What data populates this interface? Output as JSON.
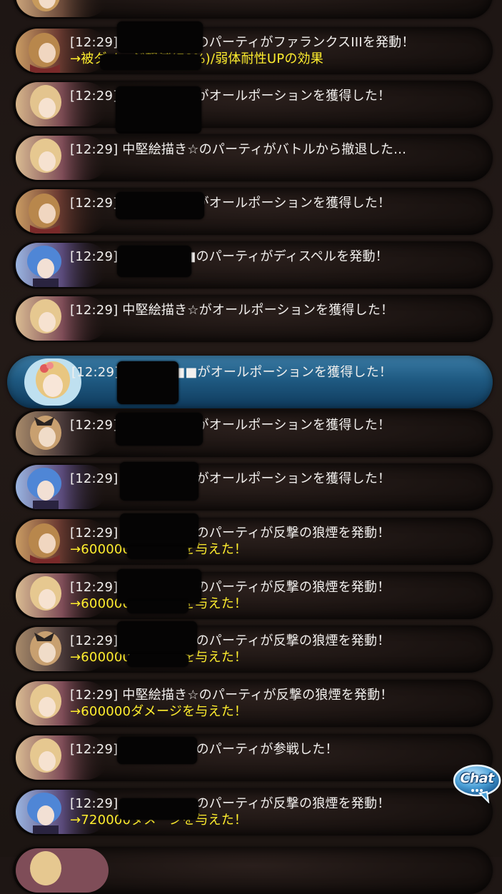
{
  "log": [
    {
      "avatar": "blonde-braid-icon",
      "line1": "[12:29]",
      "line2": ""
    },
    {
      "avatar": "blonde-braid-icon",
      "line1": "[12:29] ■■■■■■のパーティがファランクスIIIを発動！",
      "line2": "→被ダメージ軽減(70%)/弱体耐性UPの効果"
    },
    {
      "avatar": "blonde-girl-icon",
      "line1": "[12:29] ■■■■■■がオールポーションを獲得した！",
      "line2": ""
    },
    {
      "avatar": "blonde-girl-icon",
      "line1": "[12:29] 中堅絵描き☆のパーティがバトルから撤退した…",
      "line2": ""
    },
    {
      "avatar": "blonde-braid-icon",
      "line1": "[12:29] ■■■■■■がオールポーションを獲得した！",
      "line2": ""
    },
    {
      "avatar": "blue-hair-icon",
      "line1": "[12:29] ■■■■■■のパーティがディスペルを発動！",
      "line2": ""
    },
    {
      "avatar": "blonde-girl-icon",
      "line1": "[12:29] 中堅絵描き☆がオールポーションを獲得した！",
      "line2": ""
    },
    {
      "avatar": "blonde-flower-icon",
      "line1": "[12:29] ■■■■■■がオールポーションを獲得した！",
      "line2": ""
    },
    {
      "avatar": "dark-bow-icon",
      "line1": "[12:29] ■■■■■■がオールポーションを獲得した！",
      "line2": ""
    },
    {
      "avatar": "blue-hair-icon",
      "line1": "[12:29] ■■■■■■がオールポーションを獲得した！",
      "line2": ""
    },
    {
      "avatar": "blonde-braid-icon",
      "line1": "[12:29] ■■■■■■のパーティが反撃の狼煙を発動！",
      "line2": "→600000ダメージを与えた！"
    },
    {
      "avatar": "blonde-girl-icon",
      "line1": "[12:29] ■■■■■■のパーティが反撃の狼煙を発動！",
      "line2": "→600000ダメージを与えた！"
    },
    {
      "avatar": "dark-bow-icon",
      "line1": "[12:29] ■■■■■■のパーティが反撃の狼煙を発動！",
      "line2": "→600000ダメージを与えた！"
    },
    {
      "avatar": "blonde-girl-icon",
      "line1": "[12:29] 中堅絵描き☆のパーティが反撃の狼煙を発動！",
      "line2": "→600000ダメージを与えた！"
    },
    {
      "avatar": "blonde-girl-icon",
      "line1": "[12:29] ■■■■■■のパーティが参戦した！",
      "line2": ""
    },
    {
      "avatar": "blue-hair-icon",
      "line1": "[12:29] ■■■■■■のパーティが反撃の狼煙を発動！",
      "line2": "→720000ダメージを与えた！"
    }
  ],
  "chat_button": {
    "label": "Chat",
    "icon": "chat-bubble-icon"
  },
  "colors": {
    "text": "#f2f0ee",
    "effect": "#ffee2e",
    "highlight": "#1f5a82"
  }
}
